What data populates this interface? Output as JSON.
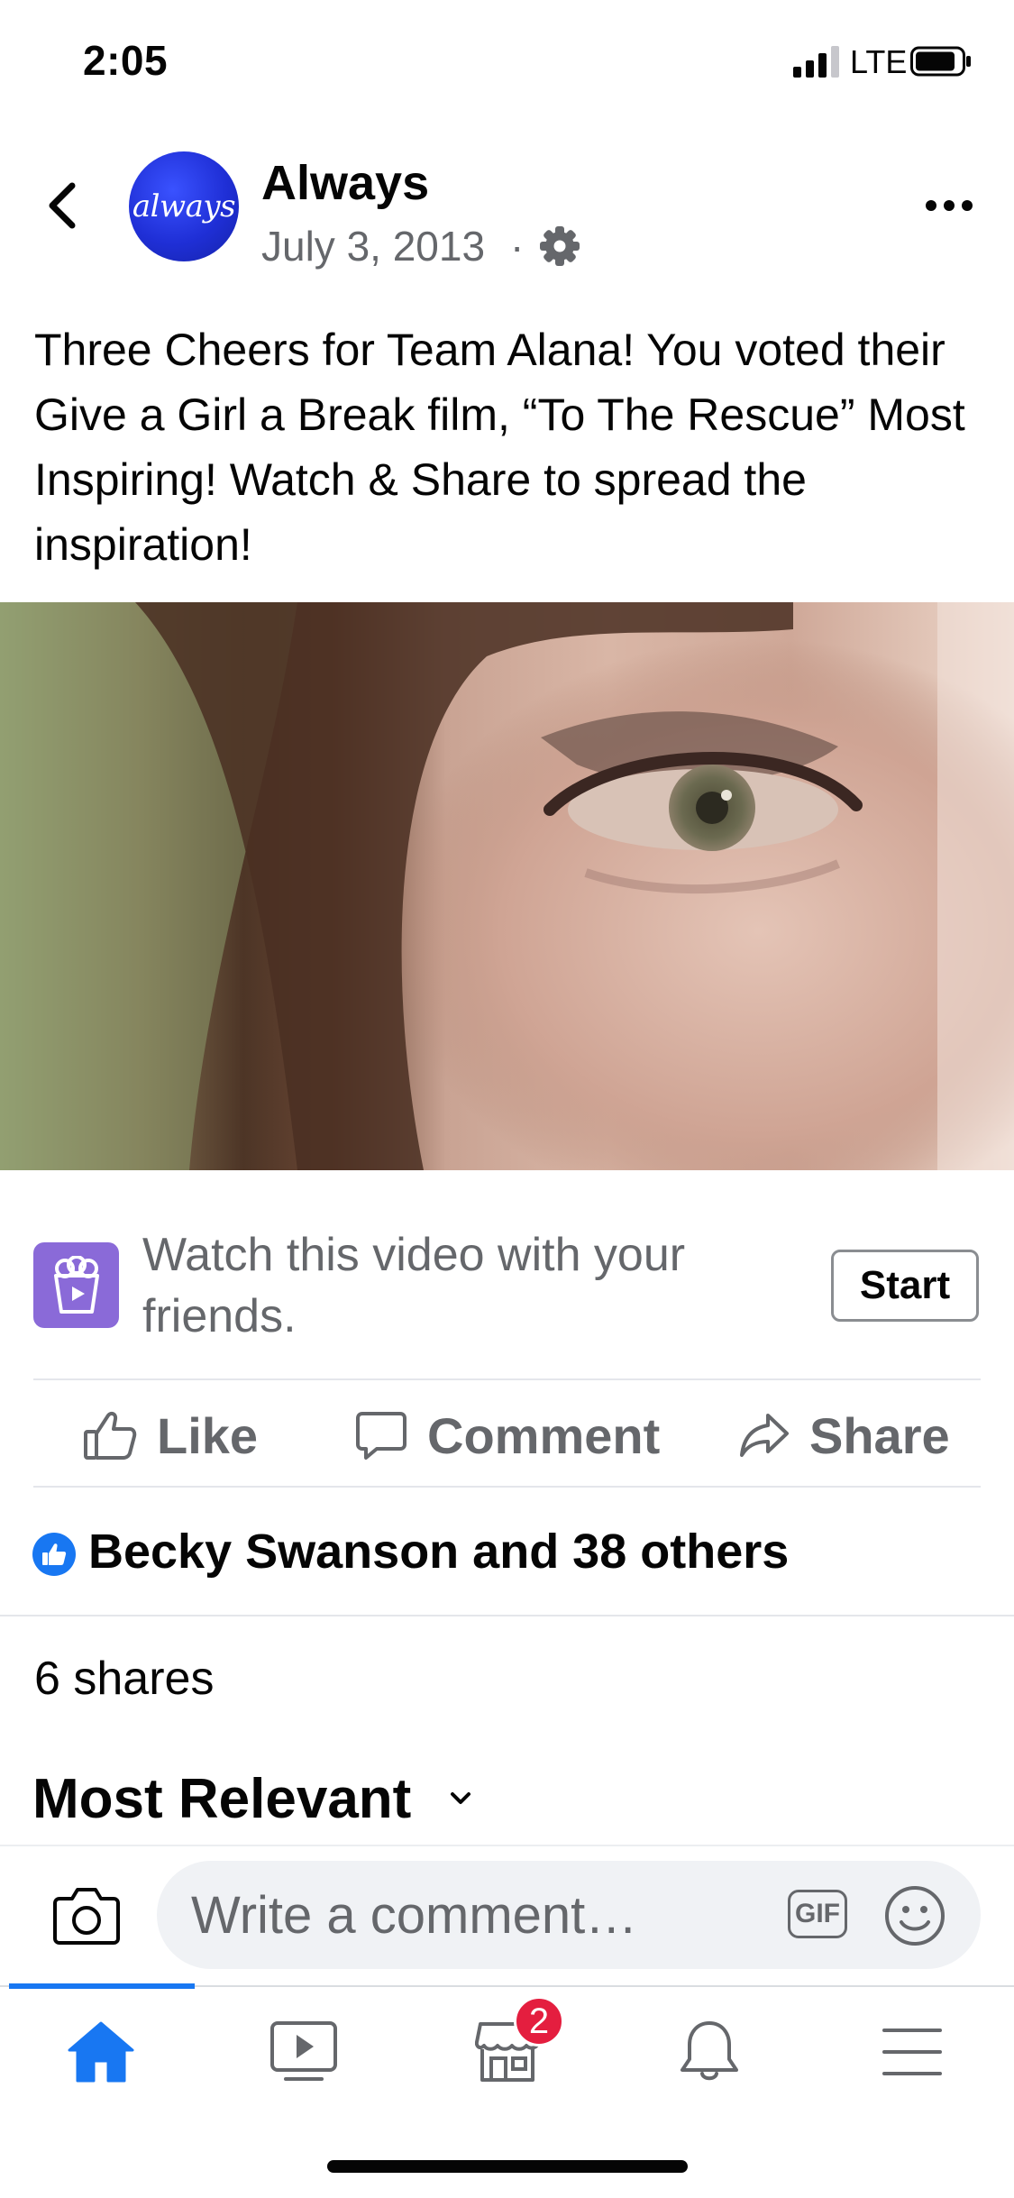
{
  "status_bar": {
    "time": "2:05",
    "network": "LTE",
    "signal_icon": "signal-bars-icon",
    "battery_icon": "battery-icon"
  },
  "post": {
    "page_name": "Always",
    "avatar_text": "always",
    "date": "July 3, 2013",
    "separator": "·",
    "caption": "Three Cheers for Team Alana! You voted their Give a Girl a Break film, “To The Rescue” Most Inspiring! Watch & Share to spread the inspiration!"
  },
  "watch_party": {
    "text": "Watch this video with your friends.",
    "start_label": "Start"
  },
  "actions": {
    "like": "Like",
    "comment": "Comment",
    "share": "Share"
  },
  "engagement": {
    "reactions": "Becky Swanson and 38 others",
    "shares": "6 shares"
  },
  "comments": {
    "sort_label": "Most Relevant"
  },
  "comment_bar": {
    "placeholder": "Write a comment…",
    "gif_label": "GIF"
  },
  "tab_bar": {
    "tabs": [
      "home",
      "watch",
      "marketplace",
      "notifications",
      "menu"
    ],
    "active": "home",
    "marketplace_badge": "2"
  },
  "colors": {
    "accent": "#1877f2",
    "secondary_text": "#65676b",
    "badge": "#e41e3f",
    "watch_party": "#8a6ad8"
  }
}
